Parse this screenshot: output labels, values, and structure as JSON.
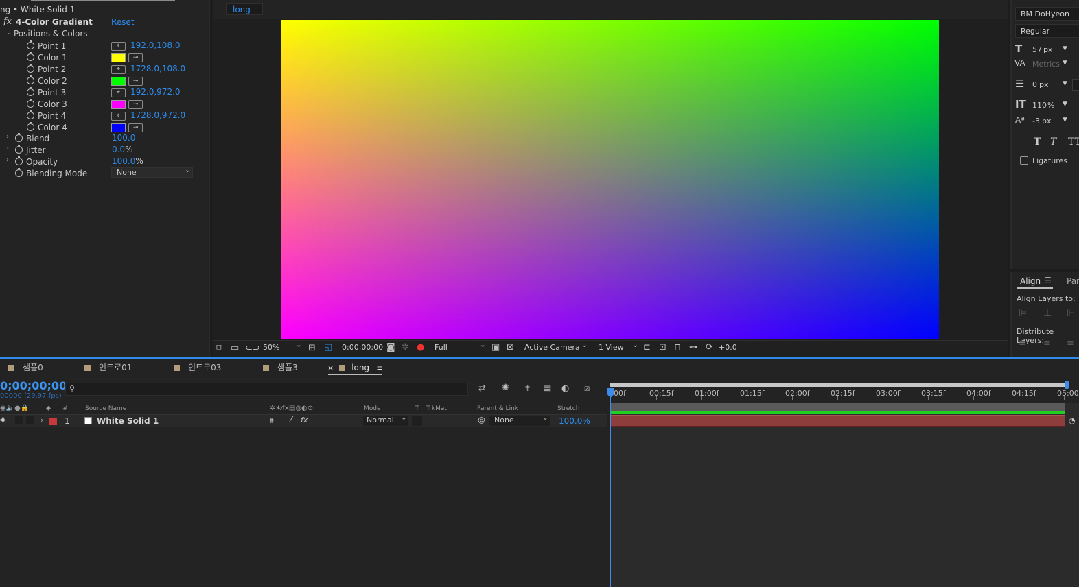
{
  "effect_controls": {
    "header": "ng • White Solid 1",
    "effect_name": "4-Color Gradient",
    "reset": "Reset",
    "group": "Positions & Colors",
    "fx": "fx",
    "rows": [
      {
        "label": "Point 1",
        "value": "192.0,108.0"
      },
      {
        "label": "Color 1",
        "color": "#ffff00"
      },
      {
        "label": "Point 2",
        "value": "1728.0,108.0"
      },
      {
        "label": "Color 2",
        "color": "#00ff00"
      },
      {
        "label": "Point 3",
        "value": "192.0,972.0"
      },
      {
        "label": "Color 3",
        "color": "#ff00ff"
      },
      {
        "label": "Point 4",
        "value": "1728.0,972.0"
      },
      {
        "label": "Color 4",
        "color": "#0000ff"
      }
    ],
    "blend_label": "Blend",
    "blend_value": "100.0",
    "jitter_label": "Jitter",
    "jitter_value": "0.0",
    "jitter_unit": "%",
    "opacity_label": "Opacity",
    "opacity_value": "100.0",
    "opacity_unit": "%",
    "blending_mode_label": "Blending Mode",
    "blending_mode_value": "None"
  },
  "viewer": {
    "tab": "long",
    "zoom": "50%",
    "timecode": "0;00;00;00",
    "resolution": "Full",
    "camera": "Active Camera",
    "views": "1 View",
    "exposure": "+0.0",
    "gradient_colors": {
      "tl": "#ffff00",
      "tr": "#00ff00",
      "bl": "#ff00ff",
      "br": "#0000ff"
    }
  },
  "character": {
    "font": "BM DoHyeon",
    "style": "Regular",
    "size": "57",
    "size_unit": "px",
    "kerning": "Metrics",
    "leading": "0",
    "leading_unit": "px",
    "vscale": "110",
    "vscale_unit": "%",
    "baseline": "-3",
    "baseline_unit": "px",
    "ligatures": "Ligatures"
  },
  "align": {
    "tab": "Align",
    "tab2": "Par",
    "align_to": "Align Layers to:",
    "distribute": "Distribute Layers:"
  },
  "timeline": {
    "tabs": [
      "샘플0",
      "인트로01",
      "인트로03",
      "샘플3",
      "long"
    ],
    "timecode": "0;00;00;00",
    "fps": "00000 (29.97 fps)",
    "columns": {
      "num": "#",
      "source": "Source Name",
      "mode": "Mode",
      "t": "T",
      "trkmat": "TrkMat",
      "parent": "Parent & Link",
      "stretch": "Stretch"
    },
    "layer": {
      "num": "1",
      "name": "White Solid 1",
      "mode": "Normal",
      "parent": "None",
      "stretch": "100.0%"
    },
    "ruler": [
      "00f",
      "00:15f",
      "01:00f",
      "01:15f",
      "02:00f",
      "02:15f",
      "03:00f",
      "03:15f",
      "04:00f",
      "04:15f",
      "05:00"
    ]
  }
}
